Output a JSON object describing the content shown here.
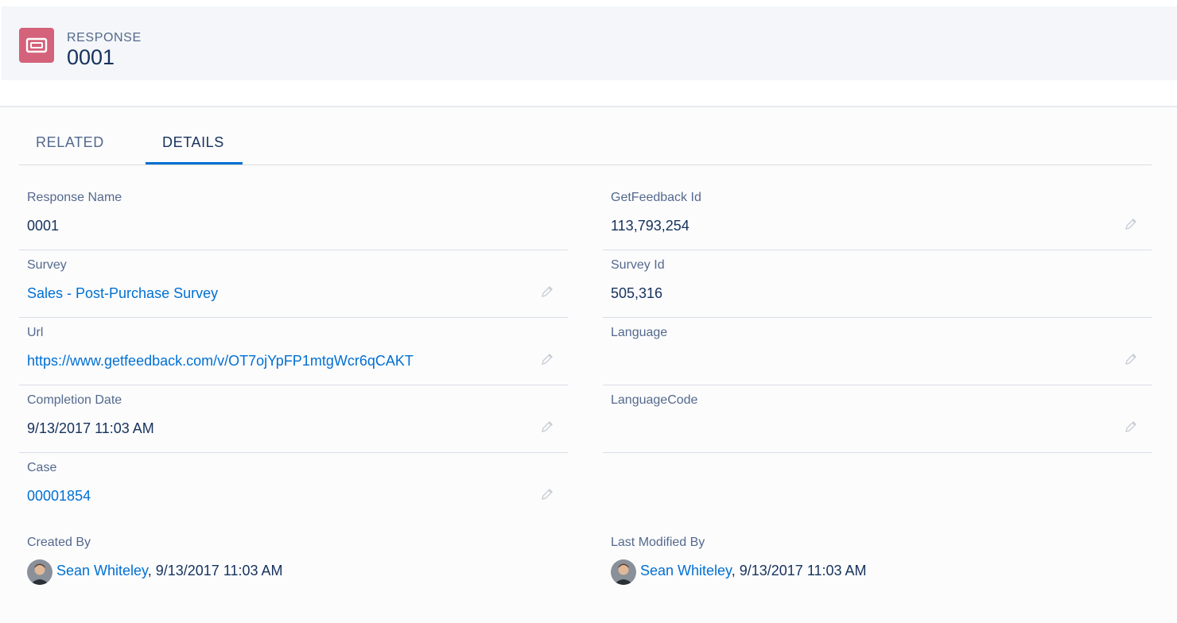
{
  "header": {
    "record_type": "RESPONSE",
    "record_name": "0001",
    "icon": "ticket-icon",
    "icon_color": "#d4627a"
  },
  "tabs": [
    {
      "label": "RELATED",
      "active": false
    },
    {
      "label": "DETAILS",
      "active": true
    }
  ],
  "fields": {
    "response_name": {
      "label": "Response Name",
      "value": "0001"
    },
    "getfeedback_id": {
      "label": "GetFeedback Id",
      "value": "113,793,254"
    },
    "survey": {
      "label": "Survey",
      "value": "Sales - Post-Purchase Survey"
    },
    "survey_id": {
      "label": "Survey Id",
      "value": "505,316"
    },
    "url": {
      "label": "Url",
      "value": "https://www.getfeedback.com/v/OT7ojYpFP1mtgWcr6qCAKT"
    },
    "language": {
      "label": "Language",
      "value": ""
    },
    "completion_date": {
      "label": "Completion Date",
      "value": "9/13/2017 11:03 AM"
    },
    "language_code": {
      "label": "LanguageCode",
      "value": ""
    },
    "case": {
      "label": "Case",
      "value": "00001854"
    }
  },
  "created_by": {
    "label": "Created By",
    "user": "Sean Whiteley",
    "timestamp": ", 9/13/2017 11:03 AM"
  },
  "last_modified_by": {
    "label": "Last Modified By",
    "user": "Sean Whiteley",
    "timestamp": ", 9/13/2017 11:03 AM"
  },
  "colors": {
    "link": "#0070d2",
    "text": "#16325c",
    "label": "#54698d",
    "tab_active": "#0070d2"
  }
}
